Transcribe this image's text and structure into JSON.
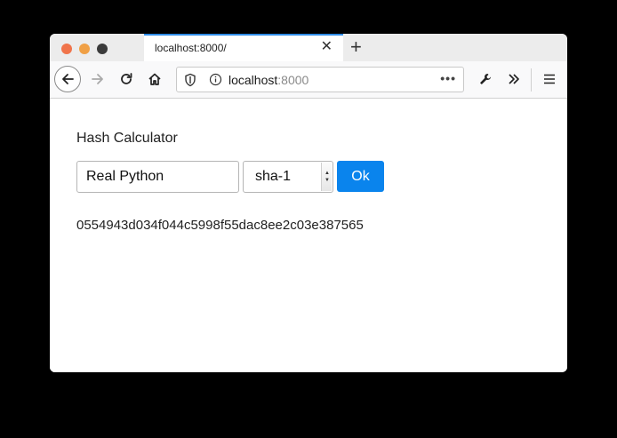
{
  "tab": {
    "title": "localhost:8000/"
  },
  "urlbar": {
    "host": "localhost",
    "port": ":8000",
    "more": "•••"
  },
  "page": {
    "title": "Hash Calculator",
    "input_value": "Real Python",
    "algorithm": "sha-1",
    "ok_label": "Ok",
    "result": "0554943d034f044c5998f55dac8ee2c03e387565"
  },
  "colors": {
    "accent": "#0a84ed",
    "tab_highlight": "#2f8ce7",
    "close_light": "#f0744b",
    "minimize_light": "#f0a045"
  }
}
